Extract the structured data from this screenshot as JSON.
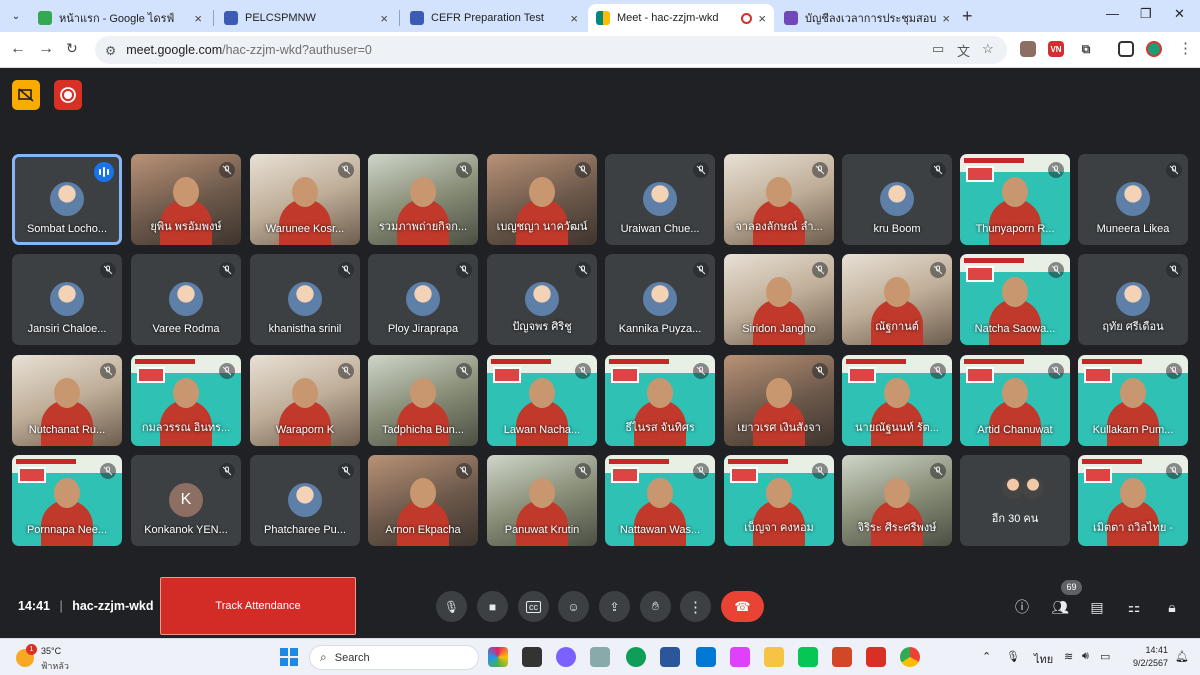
{
  "tabs": [
    {
      "title": "หน้าแรก - Google ไดรฟ์",
      "fav_color": "#34a853",
      "active": false
    },
    {
      "title": "PELCSPMNW",
      "fav_color": "#3b5bb5",
      "active": false
    },
    {
      "title": "CEFR Preparation Test",
      "fav_color": "#3b5bb5",
      "active": false
    },
    {
      "title": "Meet - hac-zzjm-wkd",
      "fav_color": "#00897b",
      "active": true
    },
    {
      "title": "บัญชีลงเวลาการประชุมสอบ CEFR ปี",
      "fav_color": "#7248b9",
      "active": false
    }
  ],
  "url": {
    "domain": "meet.google.com",
    "path": "/hac-zzjm-wkd?authuser=0"
  },
  "participants": [
    {
      "name": "Sombat Locho...",
      "kind": "avatar-pic",
      "speaking": true
    },
    {
      "name": "ยุพิน พรอัมพงษ์",
      "kind": "video"
    },
    {
      "name": "Warunee Kosr...",
      "kind": "video2"
    },
    {
      "name": "รวมภาพถ่ายกิจก...",
      "kind": "video3"
    },
    {
      "name": "เบญชญา นาควัฒน์",
      "kind": "video"
    },
    {
      "name": "Uraiwan Chue...",
      "kind": "avatar-pic"
    },
    {
      "name": "จาลองลักษณ์ ลำ...",
      "kind": "video2"
    },
    {
      "name": "kru Boom",
      "kind": "avatar-pic"
    },
    {
      "name": "Thunyaporn R...",
      "kind": "slide"
    },
    {
      "name": "Muneera Likea",
      "kind": "avatar-pic"
    },
    {
      "name": "Jansiri Chaloe...",
      "kind": "avatar-pic"
    },
    {
      "name": "Varee Rodma",
      "kind": "avatar-pic"
    },
    {
      "name": "khanistha srinil",
      "kind": "avatar-pic"
    },
    {
      "name": "Ploy Jiraprapa",
      "kind": "avatar-pic"
    },
    {
      "name": "ปัญจพร ศิริชู",
      "kind": "avatar-pic"
    },
    {
      "name": "Kannika Puyza...",
      "kind": "avatar-pic"
    },
    {
      "name": "Siridon Jangho",
      "kind": "video2"
    },
    {
      "name": "ณัฐกานต์",
      "kind": "video2"
    },
    {
      "name": "Natcha Saowa...",
      "kind": "slide"
    },
    {
      "name": "ฤทัย ศรีเดือน",
      "kind": "avatar-pic"
    },
    {
      "name": "Nutchanat Ru...",
      "kind": "video2"
    },
    {
      "name": "กมลวรรณ อินทร...",
      "kind": "slide"
    },
    {
      "name": "Waraporn K",
      "kind": "video2"
    },
    {
      "name": "Tadphicha Bun...",
      "kind": "video3"
    },
    {
      "name": "Lawan Nacha...",
      "kind": "slide"
    },
    {
      "name": "ธีไนรส จันทิศร",
      "kind": "slide"
    },
    {
      "name": "เยาวเรศ เงินสังจา",
      "kind": "video"
    },
    {
      "name": "นายณัฐนนท์ รัต...",
      "kind": "slide"
    },
    {
      "name": "Artid Chanuwat",
      "kind": "slide"
    },
    {
      "name": "Kullakarn Pum...",
      "kind": "slide"
    },
    {
      "name": "Pornnapa Nee...",
      "kind": "slide"
    },
    {
      "name": "Konkanok YEN...",
      "kind": "avatar-k",
      "initial": "K"
    },
    {
      "name": "Phatcharee Pu...",
      "kind": "avatar-pic"
    },
    {
      "name": "Arnon Ekpacha",
      "kind": "video"
    },
    {
      "name": "Panuwat Krutin",
      "kind": "video3"
    },
    {
      "name": "Nattawan Was...",
      "kind": "slide"
    },
    {
      "name": "เบ็ญจา คงหอม",
      "kind": "slide"
    },
    {
      "name": "จิริระ ศีระศรีพงษ์",
      "kind": "video3"
    },
    {
      "name": "อีก 30 คน",
      "kind": "more"
    },
    {
      "name": "เมิตตา ถวิลไทย -",
      "kind": "slide"
    }
  ],
  "meeting": {
    "time": "14:41",
    "code": "hac-zzjm-wkd",
    "participant_count": "69"
  },
  "track_button": "Track Attendance",
  "taskbar": {
    "temp": "35°C",
    "condition": "ฟ้าหลัว",
    "weather_badge": "1",
    "search_placeholder": "Search",
    "ime": "ไทย",
    "time": "14:41",
    "date": "9/2/2567"
  },
  "colors": {
    "accent": "#1a73e8",
    "end_call": "#ea4335",
    "track": "#d32c27",
    "present": "#f9ab00",
    "record": "#d93025"
  }
}
